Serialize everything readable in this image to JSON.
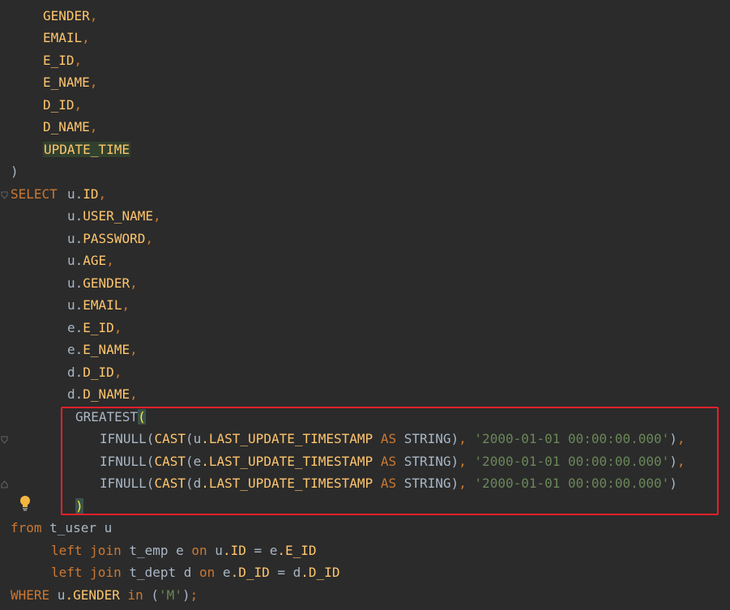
{
  "lines": [
    {
      "a": "GENDER",
      "b": ","
    },
    {
      "a": "EMAIL",
      "b": ","
    },
    {
      "a": "E_ID",
      "b": ","
    },
    {
      "a": "E_NAME",
      "b": ","
    },
    {
      "a": "D_ID",
      "b": ","
    },
    {
      "a": "D_NAME",
      "b": ","
    },
    {
      "a": "UPDATE_TIME",
      "b": ""
    }
  ],
  "close_paren": ")",
  "select_kw": "SELECT",
  "select_items": [
    {
      "alias": "u",
      "dot": ".",
      "col": "ID",
      "comma": ","
    },
    {
      "alias": "u",
      "dot": ".",
      "col": "USER_NAME",
      "comma": ","
    },
    {
      "alias": "u",
      "dot": ".",
      "col": "PASSWORD",
      "comma": ","
    },
    {
      "alias": "u",
      "dot": ".",
      "col": "AGE",
      "comma": ","
    },
    {
      "alias": "u",
      "dot": ".",
      "col": "GENDER",
      "comma": ","
    },
    {
      "alias": "u",
      "dot": ".",
      "col": "EMAIL",
      "comma": ","
    },
    {
      "alias": "e",
      "dot": ".",
      "col": "E_ID",
      "comma": ","
    },
    {
      "alias": "e",
      "dot": ".",
      "col": "E_NAME",
      "comma": ","
    },
    {
      "alias": "d",
      "dot": ".",
      "col": "D_ID",
      "comma": ","
    },
    {
      "alias": "d",
      "dot": ".",
      "col": "D_NAME",
      "comma": ","
    }
  ],
  "greatest": {
    "fn": "GREATEST",
    "open": "(",
    "close": ")"
  },
  "ifnull_rows": [
    {
      "fn": "IFNULL(",
      "cast": "CAST",
      "open": "(",
      "alias": "u",
      "col": ".LAST_UPDATE_TIMESTAMP",
      "as": "AS",
      "type": "STRING",
      "close": ")",
      "comma": ", ",
      "str": "'2000-01-01 00:00:00.000'",
      "end": ")",
      "endcomma": ","
    },
    {
      "fn": "IFNULL(",
      "cast": "CAST",
      "open": "(",
      "alias": "e",
      "col": ".LAST_UPDATE_TIMESTAMP",
      "as": "AS",
      "type": "STRING",
      "close": ")",
      "comma": ", ",
      "str": "'2000-01-01 00:00:00.000'",
      "end": ")",
      "endcomma": ","
    },
    {
      "fn": "IFNULL(",
      "cast": "CAST",
      "open": "(",
      "alias": "d",
      "col": ".LAST_UPDATE_TIMESTAMP",
      "as": "AS",
      "type": "STRING",
      "close": ")",
      "comma": ", ",
      "str": "'2000-01-01 00:00:00.000'",
      "end": ")",
      "endcomma": ""
    }
  ],
  "from_line": {
    "kw": "from",
    "table": " t_user u"
  },
  "join1": {
    "kw1": "left",
    "kw2": "join",
    "table": " t_emp e ",
    "on": "on",
    "lhs_alias": " u",
    "lhs_col": ".ID",
    "eq": " = ",
    "rhs_alias": "e",
    "rhs_col": ".E_ID"
  },
  "join2": {
    "kw1": "left",
    "kw2": "join",
    "table": " t_dept d ",
    "on": "on",
    "lhs_alias": " e",
    "lhs_col": ".D_ID",
    "eq": " = ",
    "rhs_alias": "d",
    "rhs_col": ".D_ID"
  },
  "where_line": {
    "kw": "WHERE",
    "alias": " u",
    "col": ".GENDER",
    "in": "in",
    "open": " (",
    "str": "'M'",
    "close": ")",
    "semi": ";"
  },
  "icons": {
    "fold": "fold-marker-icon",
    "bulb": "lightbulb-icon"
  },
  "colors": {
    "background": "#2b2b2b",
    "keyword": "#cc7832",
    "column": "#ffc66d",
    "string": "#6a8759",
    "text": "#a9b7c6",
    "highlight_box": "#e8202a"
  }
}
